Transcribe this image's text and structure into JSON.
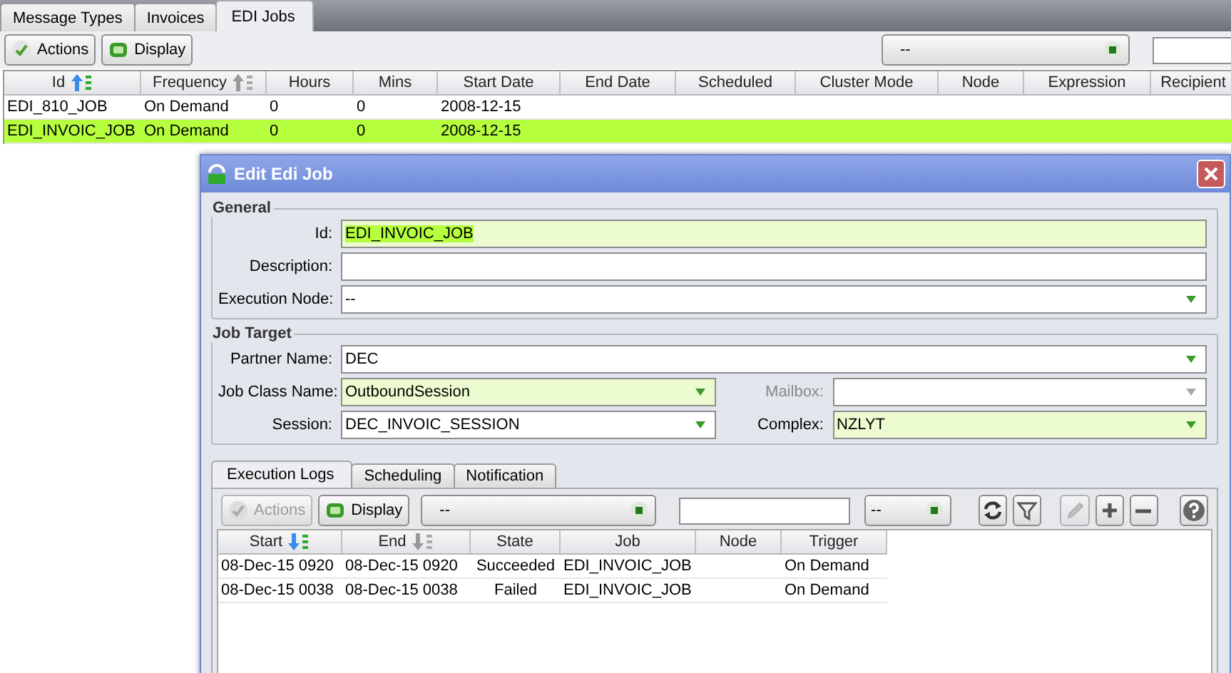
{
  "tabs": [
    {
      "label": "Message Types",
      "selected": false
    },
    {
      "label": "Invoices",
      "selected": false
    },
    {
      "label": "EDI Jobs",
      "selected": true
    }
  ],
  "toolbar": {
    "buttons": [
      {
        "label": "Actions",
        "disabled": false
      },
      {
        "label": "Display",
        "disabled": false
      }
    ],
    "filter": {
      "value": "--"
    }
  },
  "table": {
    "columns": [
      {
        "label": "Id",
        "sort_descending": false,
        "sort_active": true
      },
      {
        "label": "Frequency",
        "sort_descending": false,
        "sort_active": false
      },
      {
        "label": "Hours"
      },
      {
        "label": "Mins"
      },
      {
        "label": "Start Date"
      },
      {
        "label": "End Date"
      },
      {
        "label": "Scheduled"
      },
      {
        "label": "Cluster Mode"
      },
      {
        "label": "Node"
      },
      {
        "label": "Expression"
      },
      {
        "label": "Recipient"
      }
    ],
    "rows": [
      {
        "cells": [
          "EDI_810_JOB",
          "On Demand",
          "0",
          "0",
          "2008-12-15"
        ],
        "selected": false
      },
      {
        "cells": [
          "EDI_INVOIC_JOB",
          "On Demand",
          "0",
          "0",
          "2008-12-15"
        ],
        "selected": true
      }
    ]
  },
  "dialog": {
    "title": "Edit Edi Job",
    "sections": [
      {
        "title": "General",
        "rows": [
          [
            {
              "label": "Id:",
              "kind": "text",
              "value": "EDI_INVOIC_JOB",
              "highlighted": true,
              "text_selected": true
            }
          ],
          [
            {
              "label": "Description:",
              "kind": "text",
              "highlighted": false
            }
          ],
          [
            {
              "label": "Execution Node:",
              "kind": "dropdown",
              "value": "--",
              "highlighted": false
            }
          ]
        ]
      },
      {
        "title": "Job Target",
        "rows": [
          [
            {
              "label": "Partner Name:",
              "kind": "dropdown",
              "value": "DEC",
              "highlighted": false
            }
          ],
          [
            {
              "label": "Job Class Name:",
              "kind": "dropdown",
              "value": "OutboundSession",
              "highlighted": true
            },
            {
              "label": "Mailbox:",
              "kind": "dropdown",
              "highlighted": false,
              "disabled": true
            }
          ],
          [
            {
              "label": "Session:",
              "kind": "dropdown",
              "value": "DEC_INVOIC_SESSION",
              "highlighted": false
            },
            {
              "label": "Complex:",
              "kind": "dropdown",
              "value": "NZLYT",
              "highlighted": true
            }
          ]
        ]
      }
    ],
    "tabs": [
      {
        "label": "Execution Logs",
        "selected": true
      },
      {
        "label": "Scheduling",
        "selected": false
      },
      {
        "label": "Notification",
        "selected": false
      }
    ],
    "toolbar": {
      "buttons": [
        {
          "label": "Actions",
          "disabled": true
        },
        {
          "label": "Display",
          "disabled": false
        }
      ],
      "filter": {
        "value": "--"
      },
      "filter2": {
        "value": "--"
      },
      "tools": [
        {
          "disabled": false
        },
        {
          "disabled": false
        },
        {
          "disabled": true
        },
        {
          "disabled": false
        },
        {
          "disabled": false
        },
        {
          "disabled": false
        }
      ]
    },
    "table": {
      "columns": [
        {
          "label": "Start",
          "sort_descending": true,
          "sort_active": true
        },
        {
          "label": "End",
          "sort_descending": true,
          "sort_active": false
        },
        {
          "label": "State"
        },
        {
          "label": "Job"
        },
        {
          "label": "Node"
        },
        {
          "label": "Trigger"
        }
      ],
      "rows": [
        {
          "cells": [
            "08-Dec-15 0920",
            "08-Dec-15 0920",
            "Succeeded",
            "EDI_INVOIC_JOB",
            "",
            "On Demand"
          ],
          "selected": false
        },
        {
          "cells": [
            "08-Dec-15 0038",
            "08-Dec-15 0038",
            "Failed",
            "EDI_INVOIC_JOB",
            "",
            "On Demand"
          ],
          "selected": false
        }
      ]
    }
  }
}
